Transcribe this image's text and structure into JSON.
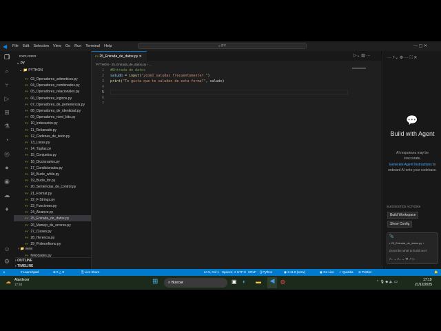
{
  "menu": [
    "File",
    "Edit",
    "Selection",
    "View",
    "Go",
    "Run",
    "Terminal",
    "Help"
  ],
  "search": "PY",
  "explorer": {
    "title": "EXPLORER",
    "root": "PY",
    "folder": "PYTHON",
    "files": [
      "03_Operadores_aritmeticos.py",
      "04_Operadores_combinados.py",
      "05_Operadores_relacionales.py",
      "06_Operadores_logicos.py",
      "07_Operadores_de_pertenencia.py",
      "08_Operadores_de_identidad.py",
      "09_Operadores_nivel_bits.py",
      "10_Indexación.py",
      "11_Rebanado.py",
      "12_Cadenas_de_texto.py",
      "13_Listas.py",
      "14_Tuplas.py",
      "15_Conjuntos.py",
      "16_Diccionarios.py",
      "17_Condicionales.py",
      "18_Bucle_while.py",
      "19_Bucle_for.py",
      "20_Sentencias_de_control.py",
      "21_Format.py",
      "22_F-Strings.py",
      "23_Funciones.py",
      "24_Alcance.py",
      "25_Entrada_de_datos.py",
      "26_Manejo_de_errores.py",
      "27_Clases.py",
      "28_Herencia.py",
      "29_Polimorfismo.py"
    ],
    "venv": "venv",
    "extra": "felicidades.py",
    "outline": "OUTLINE",
    "timeline": "TIMELINE"
  },
  "editor": {
    "tab": "25_Entrada_de_datos.py",
    "breadcrumb": "PYTHON › 25_Entrada_de_datos.py › ...",
    "lines": [
      "1",
      "2",
      "3",
      "4",
      "5",
      "6",
      "7"
    ],
    "code": {
      "l1": "#Entrada de datos",
      "l2a": "saludo",
      "l2b": " = ",
      "l2c": "input",
      "l2d": "(",
      "l2e": "\"¿Comó saludas frecuentemente? \"",
      "l2f": ")",
      "l3a": "print",
      "l3b": "(",
      "l3c": "\"Te gusta que te saluden de esta forma?\"",
      "l3d": ", saludo)"
    }
  },
  "chat": {
    "title": "Build with Agent",
    "warn": "AI responses may be inaccurate.",
    "link": "Generate Agent Instructions",
    "after": " to onboard AI onto your codebase.",
    "suggested": "SUGGESTED ACTIONS",
    "actions": [
      "Build Workspace",
      "Show Config"
    ],
    "file": "25_Entrada_de_datos.py",
    "placeholder": "Describe what to build next"
  },
  "status": {
    "launchpad": "Launchpad",
    "errors": "0",
    "warnings": "0",
    "liveshare": "Live Share",
    "pos": "Ln 5, Col 1",
    "spaces": "Spaces: 4",
    "enc": "UTF-8",
    "eol": "CRLF",
    "lang": "Python",
    "ver": "3.11.9 (venv)",
    "golive": "Go Live",
    "quokka": "Quokka",
    "prettier": "Prettier"
  },
  "taskbar": {
    "weather": "Atardecer",
    "weather_time": "17:40",
    "search": "Buscar",
    "time": "17:19",
    "date": "21/12/2025"
  }
}
